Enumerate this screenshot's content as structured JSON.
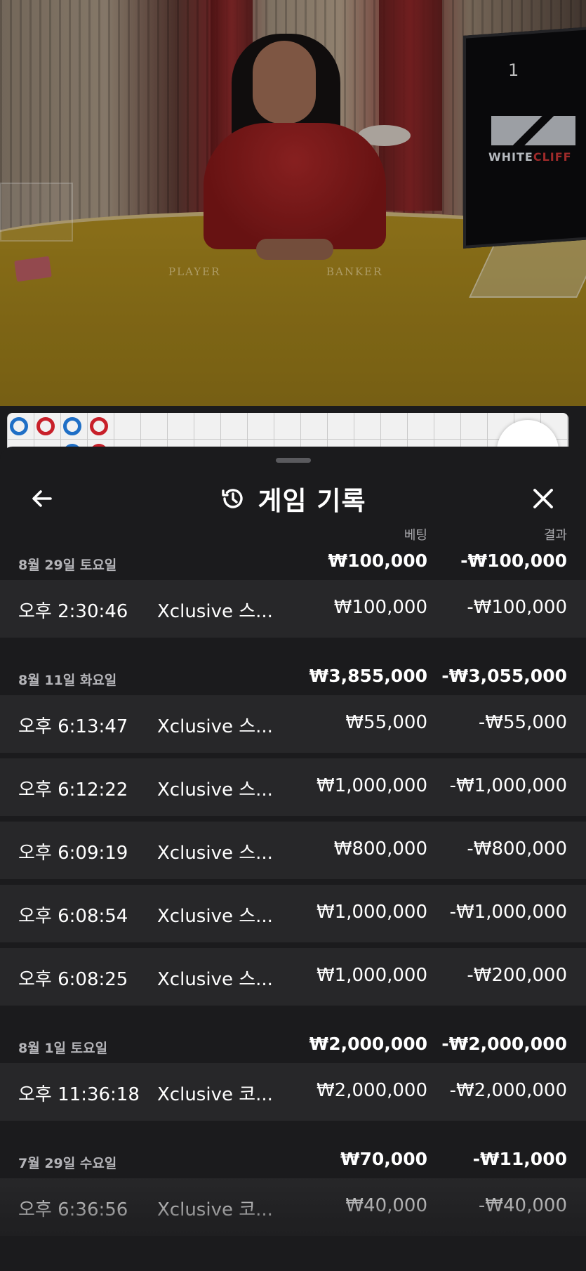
{
  "video": {
    "table_player_label": "PLAYER",
    "table_banker_label": "BANKER",
    "monitor_number": "1",
    "monitor_brand_a": "WHITE",
    "monitor_brand_b": "CLIFF"
  },
  "panel": {
    "title": "게임 기록",
    "back_icon": "arrow-left-icon",
    "history_icon": "history-clock-icon",
    "close_icon": "close-x-icon",
    "col_bet": "베팅",
    "col_result": "결과"
  },
  "groups": [
    {
      "date": "8월 29일 토요일",
      "total_bet": "₩100,000",
      "total_result": "-₩100,000",
      "rows": [
        {
          "time": "오후 2:30:46",
          "game": "Xclusive 스...",
          "bet": "₩100,000",
          "result": "-₩100,000"
        }
      ]
    },
    {
      "date": "8월 11일 화요일",
      "total_bet": "₩3,855,000",
      "total_result": "-₩3,055,000",
      "rows": [
        {
          "time": "오후 6:13:47",
          "game": "Xclusive 스...",
          "bet": "₩55,000",
          "result": "-₩55,000"
        },
        {
          "time": "오후 6:12:22",
          "game": "Xclusive 스...",
          "bet": "₩1,000,000",
          "result": "-₩1,000,000"
        },
        {
          "time": "오후 6:09:19",
          "game": "Xclusive 스...",
          "bet": "₩800,000",
          "result": "-₩800,000"
        },
        {
          "time": "오후 6:08:54",
          "game": "Xclusive 스...",
          "bet": "₩1,000,000",
          "result": "-₩1,000,000"
        },
        {
          "time": "오후 6:08:25",
          "game": "Xclusive 스...",
          "bet": "₩1,000,000",
          "result": "-₩200,000"
        }
      ]
    },
    {
      "date": "8월 1일 토요일",
      "total_bet": "₩2,000,000",
      "total_result": "-₩2,000,000",
      "rows": [
        {
          "time": "오후 11:36:18",
          "game": "Xclusive 코...",
          "bet": "₩2,000,000",
          "result": "-₩2,000,000"
        }
      ]
    },
    {
      "date": "7월 29일 수요일",
      "total_bet": "₩70,000",
      "total_result": "-₩11,000",
      "rows": [
        {
          "time": "오후 6:36:56",
          "game": "Xclusive 코...",
          "bet": "₩40,000",
          "result": "-₩40,000"
        }
      ]
    }
  ],
  "colors": {
    "panel_bg": "#1b1b1d",
    "row_bg": "#272729",
    "player_blue": "#1f6fc6",
    "banker_red": "#c8202a"
  }
}
